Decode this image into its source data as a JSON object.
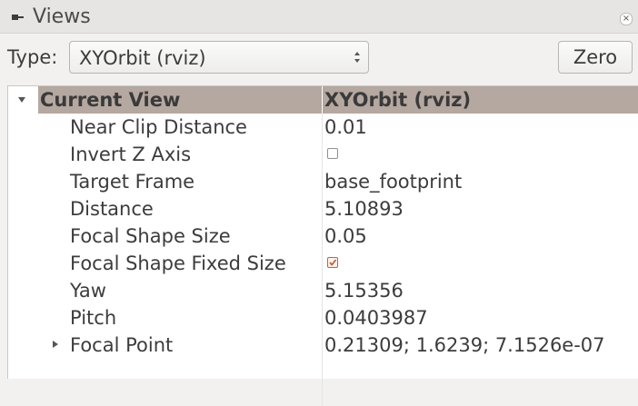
{
  "panel": {
    "title": "Views",
    "close_glyph": "×",
    "type_label": "Type:",
    "type_value": "XYOrbit (rviz)",
    "zero_label": "Zero"
  },
  "tree": {
    "header": {
      "name": "Current View",
      "value": "XYOrbit (rviz)"
    },
    "rows": [
      {
        "name": "Near Clip Distance",
        "value": "0.01"
      },
      {
        "name": "Invert Z Axis",
        "checked": false
      },
      {
        "name": "Target Frame",
        "value": "base_footprint"
      },
      {
        "name": "Distance",
        "value": "5.10893"
      },
      {
        "name": "Focal Shape Size",
        "value": "0.05"
      },
      {
        "name": "Focal Shape Fixed Size",
        "checked": true
      },
      {
        "name": "Yaw",
        "value": "5.15356"
      },
      {
        "name": "Pitch",
        "value": "0.0403987"
      },
      {
        "name": "Focal Point",
        "value": "0.21309; 1.6239; 7.1526e-07"
      }
    ]
  },
  "colors": {
    "header_bg": "#b5a8a0",
    "checkbox_checked": "#c4623a"
  },
  "icons": [
    "views-panel-icon",
    "close-icon",
    "spinner-arrows-icon",
    "expand-triangle-down-icon",
    "expand-triangle-right-icon",
    "checkbox-checked-icon"
  ]
}
